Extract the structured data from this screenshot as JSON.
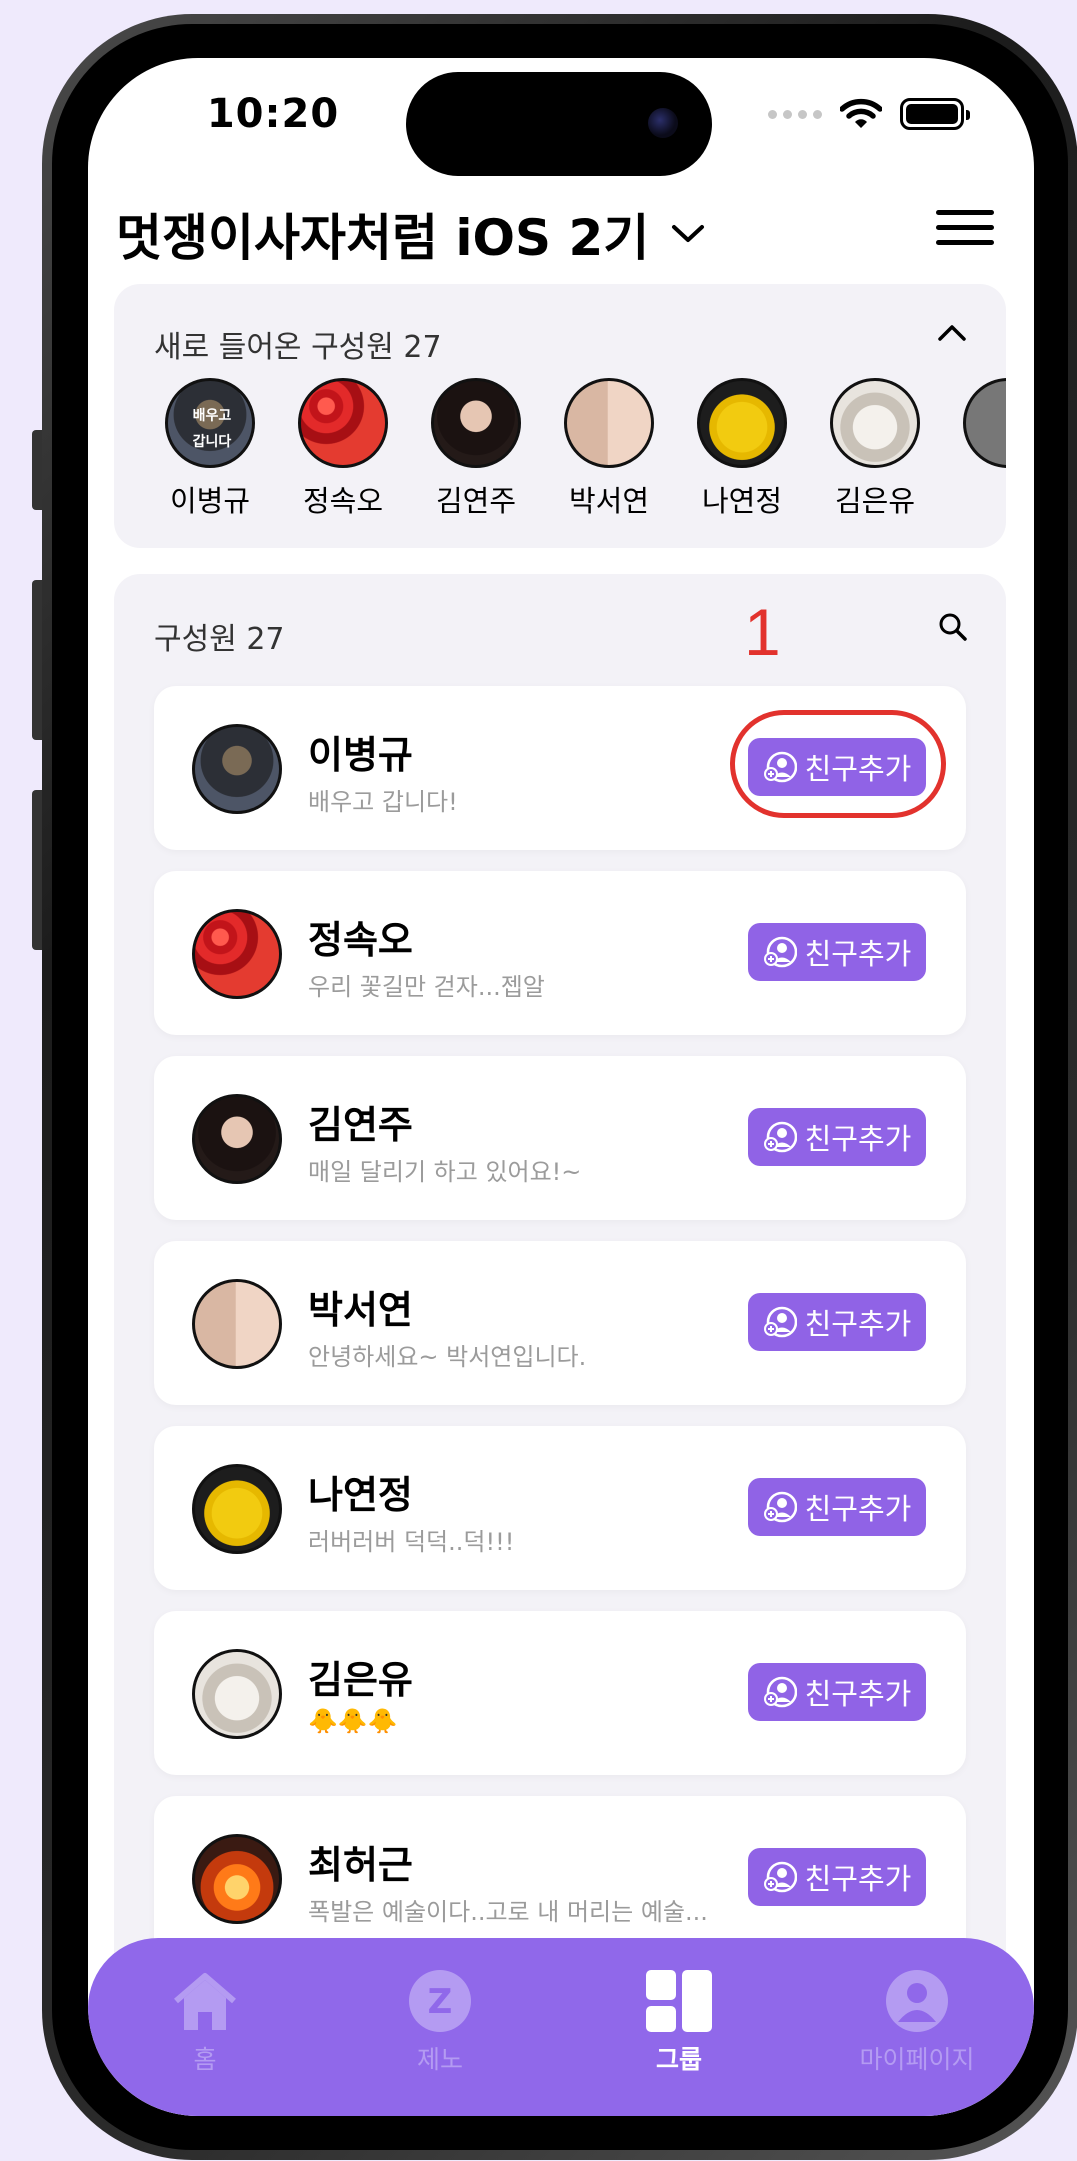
{
  "status_bar": {
    "time": "10:20"
  },
  "header": {
    "title": "멋쟁이사자처럼 iOS 2기"
  },
  "new_members": {
    "title": "새로 들어온 구성원 27",
    "items": [
      {
        "name": "이병규",
        "avatar_text": "배우고 갑니다"
      },
      {
        "name": "정속오"
      },
      {
        "name": "김연주"
      },
      {
        "name": "박서연"
      },
      {
        "name": "나연정"
      },
      {
        "name": "김은유"
      }
    ]
  },
  "members": {
    "title": "구성원 27",
    "annotation_number": "1",
    "rows": [
      {
        "name": "이병규",
        "desc": "배우고 갑니다!",
        "button": "친구추가"
      },
      {
        "name": "정속오",
        "desc": "우리 꽃길만 걷자...젭알",
        "button": "친구추가"
      },
      {
        "name": "김연주",
        "desc": "매일 달리기 하고 있어요!~",
        "button": "친구추가"
      },
      {
        "name": "박서연",
        "desc": "안녕하세요~ 박서연입니다.",
        "button": "친구추가"
      },
      {
        "name": "나연정",
        "desc": "러버러버 덕덕..덕!!!",
        "button": "친구추가"
      },
      {
        "name": "김은유",
        "desc": "🐥🐥🐥",
        "button": "친구추가"
      },
      {
        "name": "최허근",
        "desc": "폭발은 예술이다..고로 내 머리는 예술...",
        "button": "친구추가"
      }
    ]
  },
  "tabbar": {
    "tabs": [
      {
        "label": "홈",
        "icon": "home-icon",
        "active": false
      },
      {
        "label": "제노",
        "icon": "zeno-z-icon",
        "active": false
      },
      {
        "label": "그룹",
        "icon": "group-grid-icon",
        "active": true
      },
      {
        "label": "마이페이지",
        "icon": "person-icon",
        "active": false
      }
    ],
    "accent": "#9068ea"
  },
  "colors": {
    "button": "#9063e6",
    "annotation": "#e2322d",
    "background": "#efeafc"
  }
}
